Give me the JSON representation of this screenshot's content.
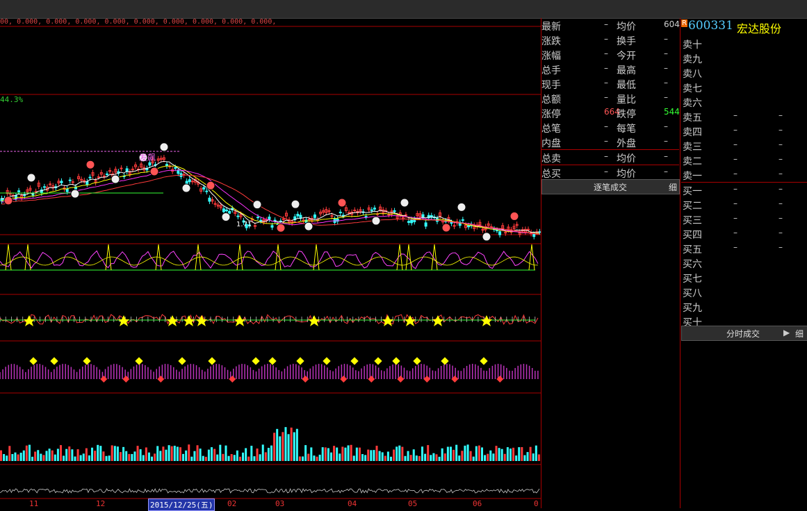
{
  "indicator_values": "00, 0.000, 0.000, 0.000, 0.000, 0.000, 0.000, 0.000, 0.000, 0.000,",
  "pct_label": "44.3%",
  "annotation": "发飙",
  "price_low_label": "1.71",
  "xaxis": {
    "labels": [
      "11",
      "12",
      "2015/12/25(五)",
      "02",
      "03",
      "04",
      "05",
      "06",
      "0"
    ]
  },
  "stock": {
    "code": "600331",
    "name": "宏达股份",
    "badge": "R"
  },
  "quote": {
    "rows": [
      {
        "l1": "最新",
        "v1": "–",
        "l2": "均价",
        "v2": "604",
        "c2": "#ccc"
      },
      {
        "l1": "涨跌",
        "v1": "–",
        "l2": "换手",
        "v2": "–",
        "c2": "#ccc"
      },
      {
        "l1": "涨幅",
        "v1": "–",
        "l2": "今开",
        "v2": "–",
        "c2": "#ccc"
      },
      {
        "l1": "总手",
        "v1": "–",
        "l2": "最高",
        "v2": "–",
        "c2": "#ccc"
      },
      {
        "l1": "现手",
        "v1": "–",
        "l2": "最低",
        "v2": "–",
        "c2": "#ccc"
      },
      {
        "l1": "总额",
        "v1": "–",
        "l2": "量比",
        "v2": "–",
        "c2": "#ccc"
      },
      {
        "l1": "涨停",
        "v1": "664",
        "l2": "跌停",
        "v2": "544",
        "c2": "#3f3"
      },
      {
        "l1": "总笔",
        "v1": "–",
        "l2": "每笔",
        "v2": "–",
        "c2": "#ccc"
      },
      {
        "l1": "内盘",
        "v1": "–",
        "l2": "外盘",
        "v2": "–",
        "c2": "#ccc"
      },
      {
        "l1": "总卖",
        "v1": "–",
        "l2": "均价",
        "v2": "–",
        "c2": "#ccc"
      },
      {
        "l1": "总买",
        "v1": "–",
        "l2": "均价",
        "v2": "–",
        "c2": "#ccc"
      }
    ],
    "tab_label": "逐笔成交",
    "tab_btn": "细"
  },
  "book": {
    "sell": [
      {
        "label": "卖十",
        "p": "",
        "v": ""
      },
      {
        "label": "卖九",
        "p": "",
        "v": ""
      },
      {
        "label": "卖八",
        "p": "",
        "v": ""
      },
      {
        "label": "卖七",
        "p": "",
        "v": ""
      },
      {
        "label": "卖六",
        "p": "",
        "v": ""
      },
      {
        "label": "卖五",
        "p": "–",
        "v": "–"
      },
      {
        "label": "卖四",
        "p": "–",
        "v": "–"
      },
      {
        "label": "卖三",
        "p": "–",
        "v": "–"
      },
      {
        "label": "卖二",
        "p": "–",
        "v": "–"
      },
      {
        "label": "卖一",
        "p": "–",
        "v": "–"
      }
    ],
    "buy": [
      {
        "label": "买一",
        "p": "–",
        "v": "–"
      },
      {
        "label": "买二",
        "p": "–",
        "v": "–"
      },
      {
        "label": "买三",
        "p": "–",
        "v": "–"
      },
      {
        "label": "买四",
        "p": "–",
        "v": "–"
      },
      {
        "label": "买五",
        "p": "–",
        "v": "–"
      },
      {
        "label": "买六",
        "p": "",
        "v": ""
      },
      {
        "label": "买七",
        "p": "",
        "v": ""
      },
      {
        "label": "买八",
        "p": "",
        "v": ""
      },
      {
        "label": "买九",
        "p": "",
        "v": ""
      },
      {
        "label": "买十",
        "p": "",
        "v": ""
      }
    ],
    "tab_label": "分时成交",
    "tab_arrow": "▶",
    "tab_btn": "细"
  },
  "colors": {
    "grid": "#aa0000",
    "up": "#ff3b3b",
    "down": "#33ffff",
    "ma1": "#ffffff",
    "ma2": "#ffff00",
    "ma3": "#ff33ff",
    "ma4": "#33ff33"
  }
}
